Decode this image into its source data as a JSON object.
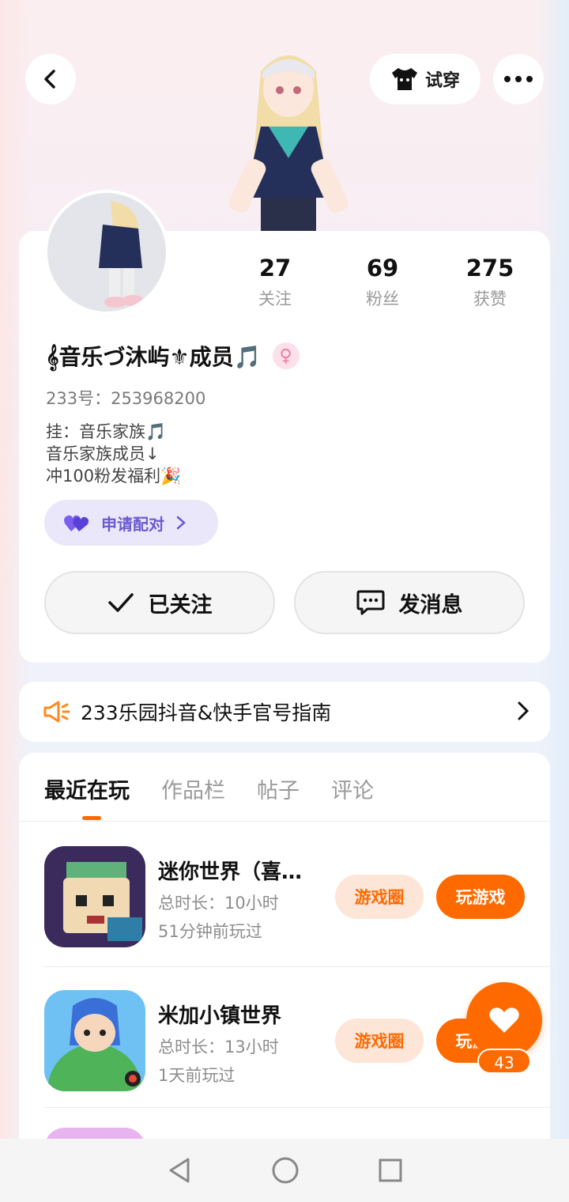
{
  "header": {
    "tryon_label": "试穿"
  },
  "stats": [
    {
      "value": "27",
      "label": "关注"
    },
    {
      "value": "69",
      "label": "粉丝"
    },
    {
      "value": "275",
      "label": "获赞"
    }
  ],
  "profile": {
    "nickname": "𝄞音乐づ沐屿⚜成员🎵",
    "gender_symbol": "♀",
    "uid": "233号：253968200",
    "bio": [
      "挂：音乐家族🎵",
      "音乐家族成员↓",
      "冲100粉发福利🎉"
    ],
    "pair_label": "申请配对",
    "follow_label": "已关注",
    "message_label": "发消息"
  },
  "notice": {
    "text": "233乐园抖音&快手官号指南"
  },
  "tabs": [
    "最近在玩",
    "作品栏",
    "帖子",
    "评论"
  ],
  "games": [
    {
      "name": "迷你世界（喜…",
      "duration": "总时长：10小时",
      "last_played": "51分钟前玩过",
      "circle_label": "游戏圈",
      "play_label": "玩游戏"
    },
    {
      "name": "米加小镇世界",
      "duration": "总时长：13小时",
      "last_played": "1天前玩过",
      "circle_label": "游戏圈",
      "play_label": "玩游戏"
    }
  ],
  "fab": {
    "count": "43"
  },
  "colors": {
    "accent": "#ff6a00",
    "pair_purple": "#6b5ad0"
  }
}
